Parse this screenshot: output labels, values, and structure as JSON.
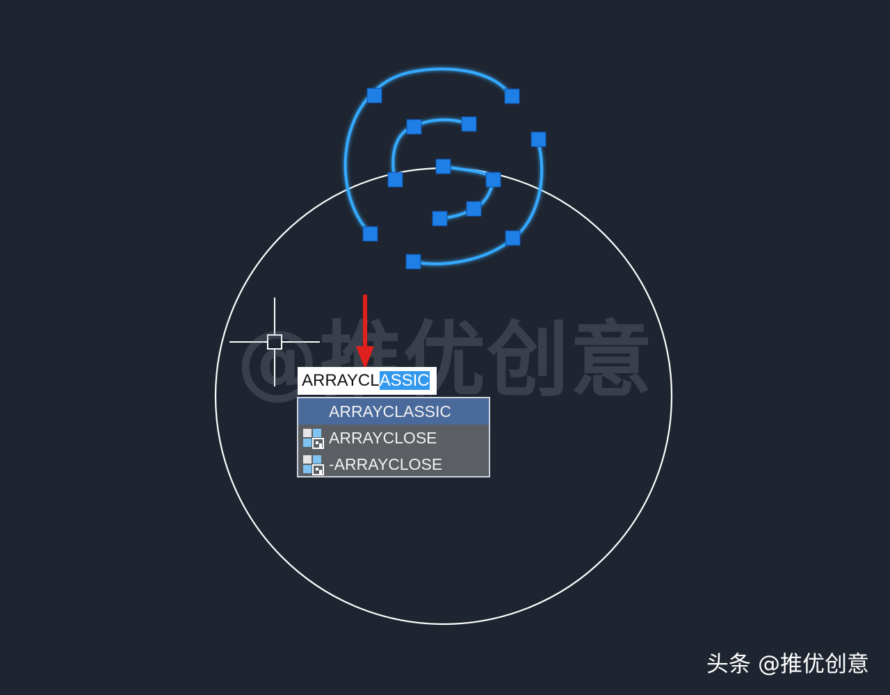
{
  "watermark": {
    "text": "@推优创意"
  },
  "command_line": {
    "typed": "ARRAYCL",
    "suggested_completion": "ASSIC"
  },
  "autocomplete": {
    "items": [
      {
        "label": "ARRAYCLASSIC",
        "selected": true,
        "icon": "none"
      },
      {
        "label": "ARRAYCLOSE",
        "selected": false,
        "icon": "array-grid-icon"
      },
      {
        "label": "-ARRAYCLOSE",
        "selected": false,
        "icon": "array-grid-icon"
      }
    ]
  },
  "footer": {
    "text": "头条 @推优创意"
  },
  "colors": {
    "background": "#1f2530",
    "selected_geometry": "#35aaff",
    "grip": "#1e7fe6",
    "annotation_arrow": "#e0201c",
    "crosshair": "#ffffff"
  }
}
